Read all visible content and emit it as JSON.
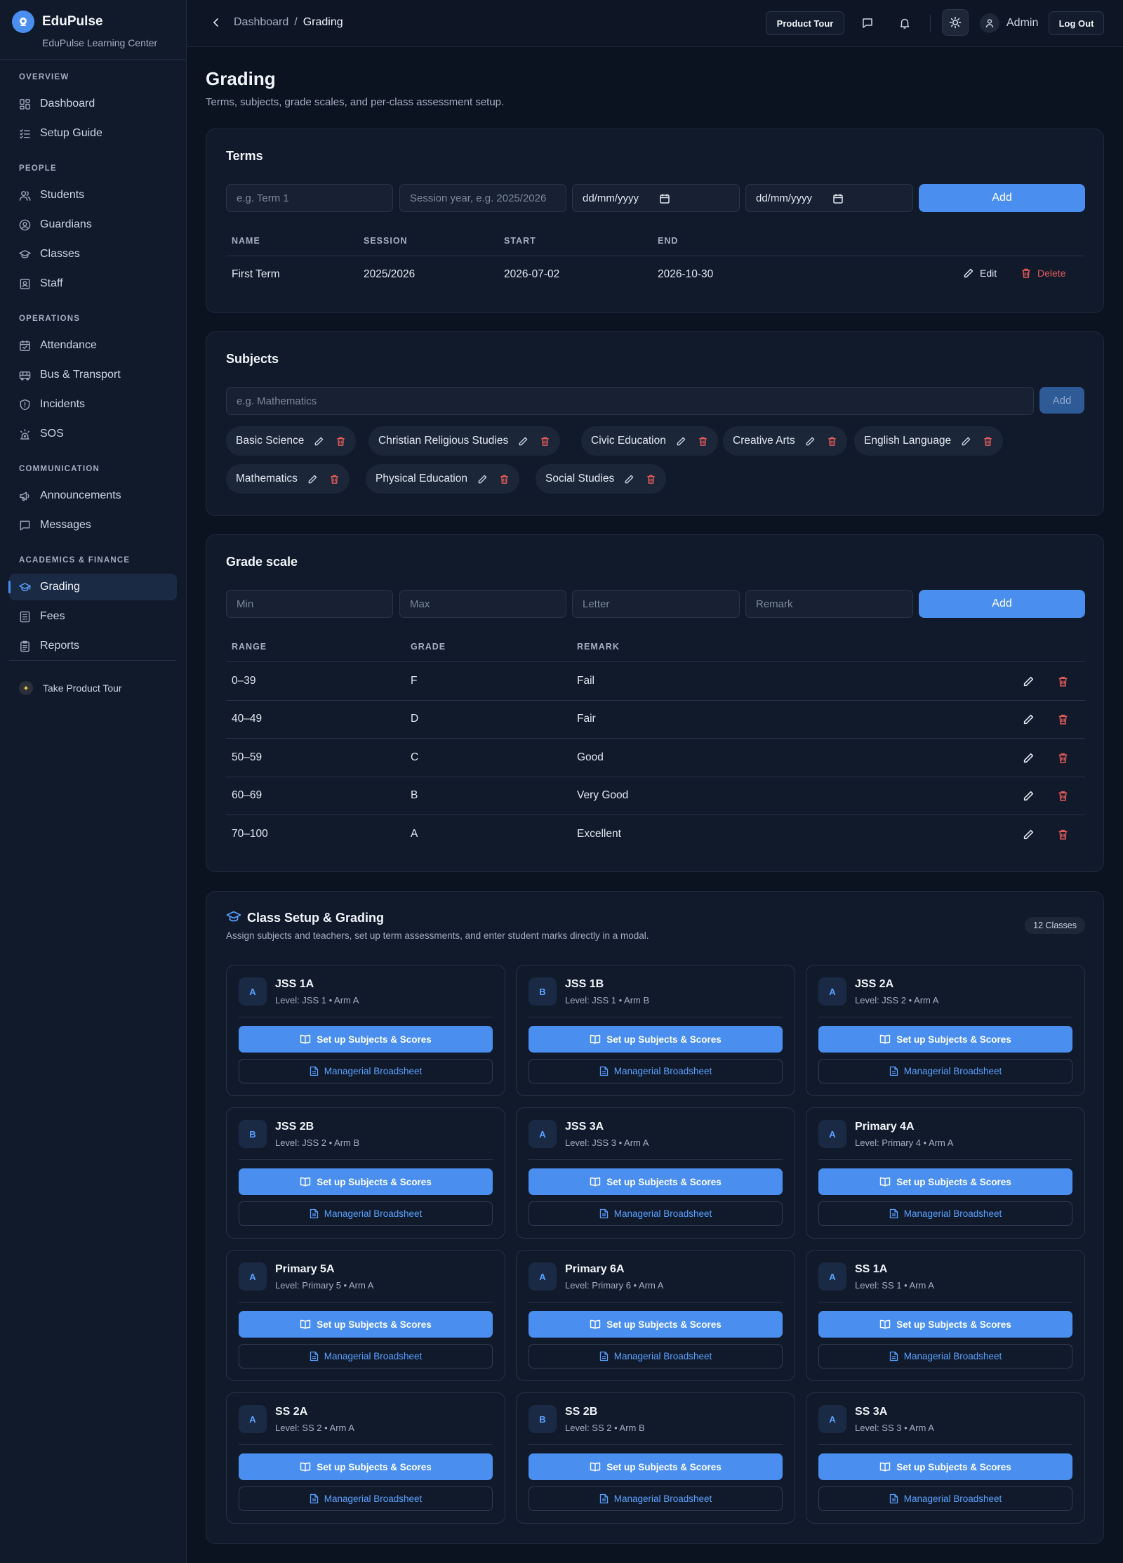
{
  "brand": {
    "name": "EduPulse",
    "subtitle": "EduPulse Learning Center"
  },
  "sidebar": {
    "sections": [
      {
        "title": "OVERVIEW",
        "items": [
          "Dashboard",
          "Setup Guide"
        ]
      },
      {
        "title": "PEOPLE",
        "items": [
          "Students",
          "Guardians",
          "Classes",
          "Staff"
        ]
      },
      {
        "title": "OPERATIONS",
        "items": [
          "Attendance",
          "Bus & Transport",
          "Incidents",
          "SOS"
        ]
      },
      {
        "title": "COMMUNICATION",
        "items": [
          "Announcements",
          "Messages"
        ]
      },
      {
        "title": "ACADEMICS & FINANCE",
        "items": [
          "Grading",
          "Fees",
          "Reports"
        ]
      }
    ],
    "active": "Grading",
    "tour": "Take Product Tour"
  },
  "topbar": {
    "crumb_parent": "Dashboard",
    "crumb_sep": "/",
    "crumb_current": "Grading",
    "tour_button": "Product Tour",
    "user": "Admin",
    "logout": "Log Out"
  },
  "page": {
    "title": "Grading",
    "subtitle": "Terms, subjects, grade scales, and per-class assessment setup."
  },
  "terms": {
    "title": "Terms",
    "inputs": {
      "name_placeholder": "e.g. Term 1",
      "session_placeholder": "Session year, e.g. 2025/2026",
      "start_value": "dd/mm/yyyy",
      "end_value": "dd/mm/yyyy"
    },
    "add_label": "Add",
    "columns": [
      "NAME",
      "SESSION",
      "START",
      "END"
    ],
    "rows": [
      {
        "name": "First Term",
        "session": "2025/2026",
        "start": "2026-07-02",
        "end": "2026-10-30"
      }
    ],
    "edit_label": "Edit",
    "delete_label": "Delete"
  },
  "subjects": {
    "title": "Subjects",
    "placeholder": "e.g. Mathematics",
    "add_label": "Add",
    "items": [
      "Basic Science",
      "Christian Religious Studies",
      "Civic Education",
      "Creative Arts",
      "English Language",
      "Mathematics",
      "Physical Education",
      "Social Studies"
    ]
  },
  "grade_scale": {
    "title": "Grade scale",
    "inputs": {
      "min": "Min",
      "max": "Max",
      "letter": "Letter",
      "remark": "Remark"
    },
    "add_label": "Add",
    "columns": [
      "RANGE",
      "GRADE",
      "REMARK"
    ],
    "rows": [
      {
        "range": "0–39",
        "grade": "F",
        "remark": "Fail"
      },
      {
        "range": "40–49",
        "grade": "D",
        "remark": "Fair"
      },
      {
        "range": "50–59",
        "grade": "C",
        "remark": "Good"
      },
      {
        "range": "60–69",
        "grade": "B",
        "remark": "Very Good"
      },
      {
        "range": "70–100",
        "grade": "A",
        "remark": "Excellent"
      }
    ]
  },
  "class_setup": {
    "title": "Class Setup & Grading",
    "subtitle": "Assign subjects and teachers, set up term assessments, and enter student marks directly in a modal.",
    "count_badge": "12 Classes",
    "primary_label": "Set up Subjects & Scores",
    "secondary_label": "Managerial Broadsheet",
    "classes": [
      {
        "arm": "A",
        "name": "JSS 1A",
        "level": "Level: JSS 1 • Arm A"
      },
      {
        "arm": "B",
        "name": "JSS 1B",
        "level": "Level: JSS 1 • Arm B"
      },
      {
        "arm": "A",
        "name": "JSS 2A",
        "level": "Level: JSS 2 • Arm A"
      },
      {
        "arm": "B",
        "name": "JSS 2B",
        "level": "Level: JSS 2 • Arm B"
      },
      {
        "arm": "A",
        "name": "JSS 3A",
        "level": "Level: JSS 3 • Arm A"
      },
      {
        "arm": "A",
        "name": "Primary 4A",
        "level": "Level: Primary 4 • Arm A"
      },
      {
        "arm": "A",
        "name": "Primary 5A",
        "level": "Level: Primary 5 • Arm A"
      },
      {
        "arm": "A",
        "name": "Primary 6A",
        "level": "Level: Primary 6 • Arm A"
      },
      {
        "arm": "A",
        "name": "SS 1A",
        "level": "Level: SS 1 • Arm A"
      },
      {
        "arm": "A",
        "name": "SS 2A",
        "level": "Level: SS 2 • Arm A"
      },
      {
        "arm": "B",
        "name": "SS 2B",
        "level": "Level: SS 2 • Arm B"
      },
      {
        "arm": "A",
        "name": "SS 3A",
        "level": "Level: SS 3 • Arm A"
      }
    ]
  },
  "colors": {
    "accent": "#4a8ff0",
    "danger": "#e05a5a",
    "background": "#0b1220",
    "card": "#111a2b"
  }
}
